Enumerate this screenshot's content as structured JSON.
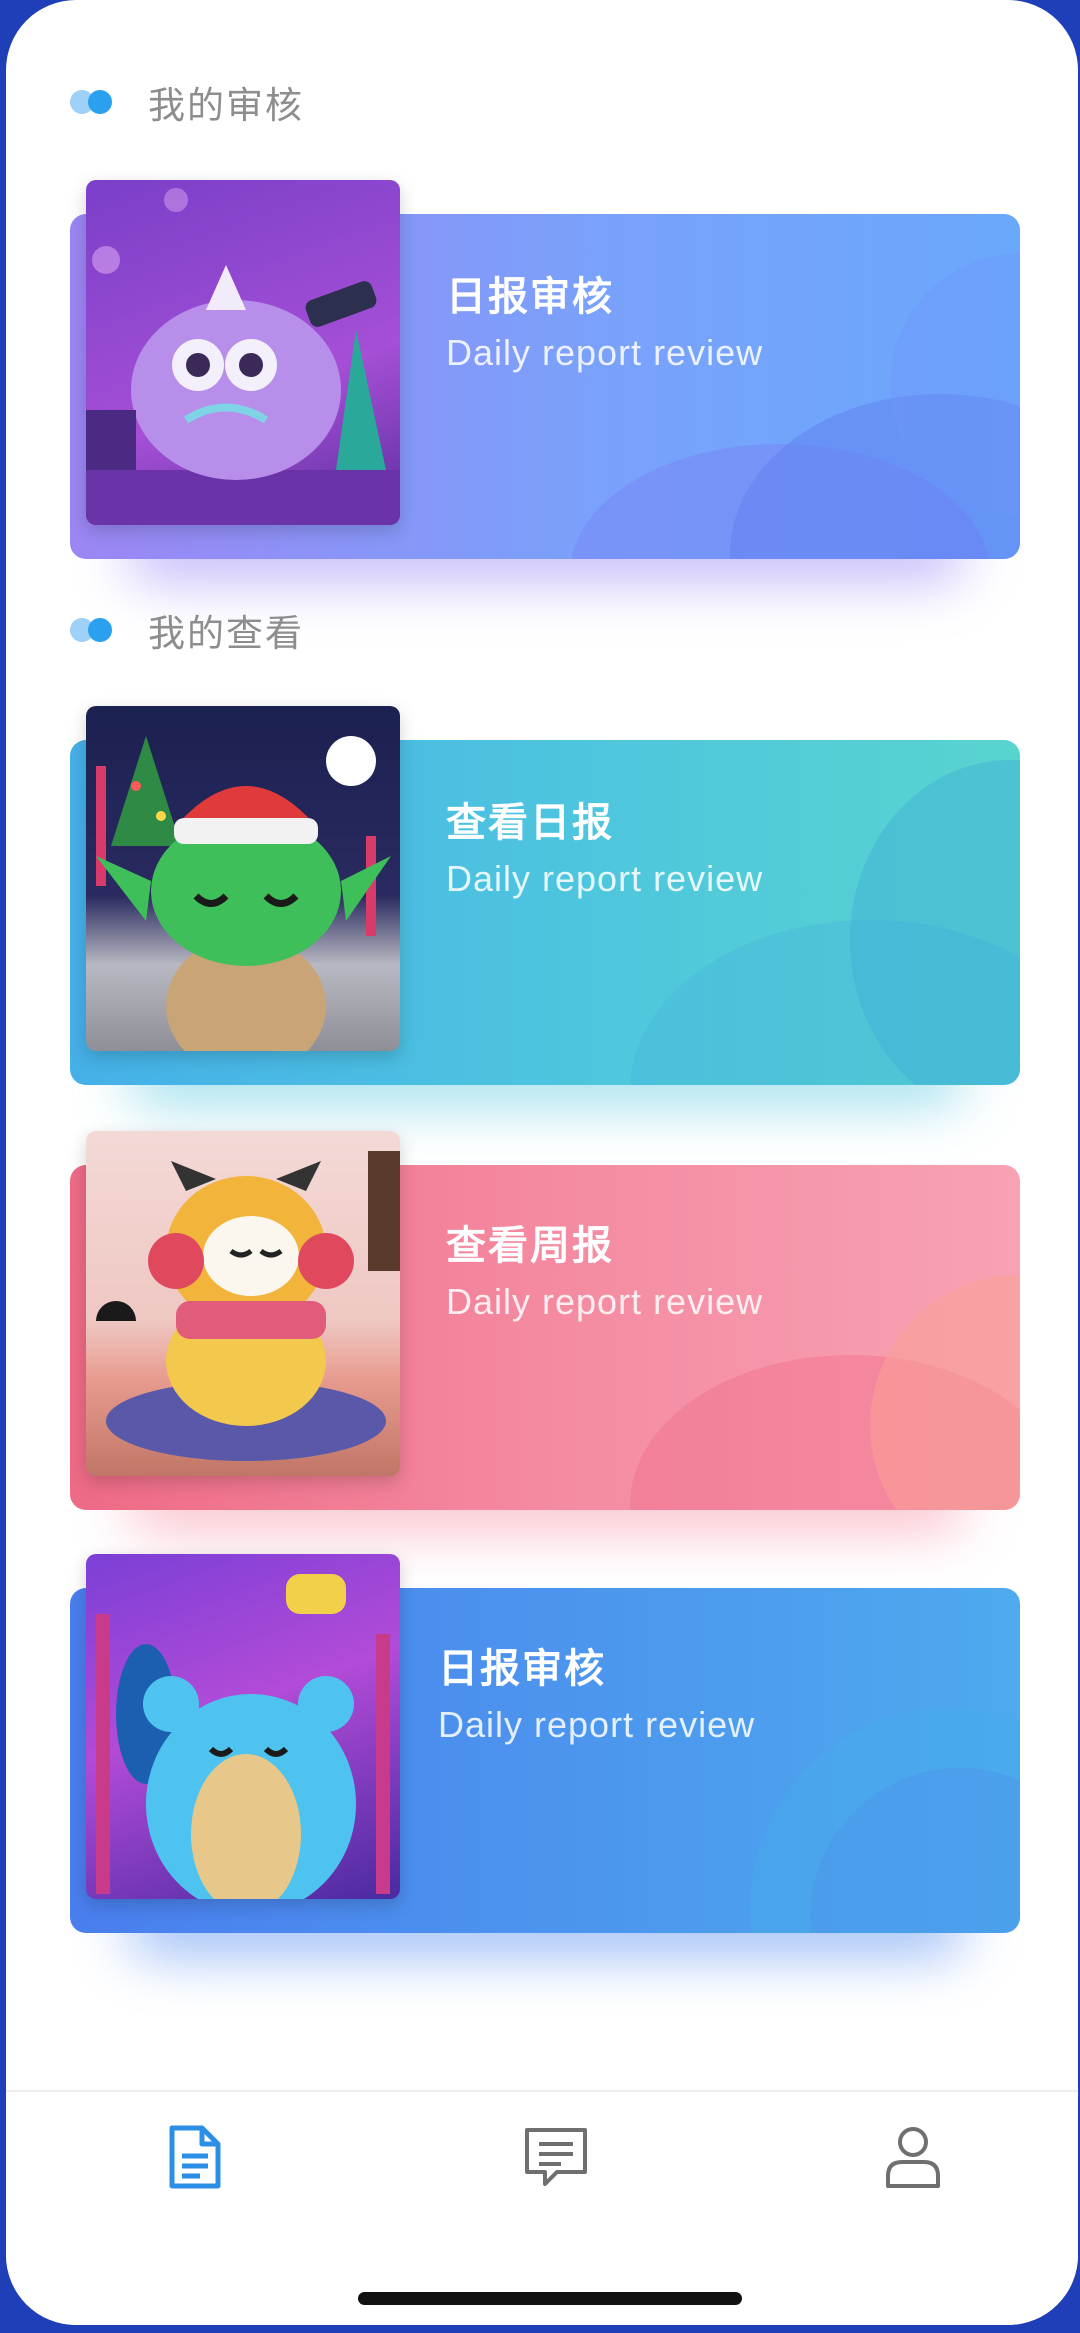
{
  "sections": {
    "review": {
      "title": "我的审核"
    },
    "view": {
      "title": "我的查看"
    }
  },
  "cards": [
    {
      "title": "日报审核",
      "subtitle": "Daily report review"
    },
    {
      "title": "查看日报",
      "subtitle": "Daily report review"
    },
    {
      "title": "查看周报",
      "subtitle": "Daily report review"
    },
    {
      "title": "日报审核",
      "subtitle": "Daily report review"
    }
  ],
  "tabbar": {
    "items": [
      {
        "icon": "document-icon",
        "active": true,
        "color": "#2b8fe6"
      },
      {
        "icon": "message-icon",
        "active": false,
        "color": "#6f6f6f"
      },
      {
        "icon": "user-icon",
        "active": false,
        "color": "#6f6f6f"
      }
    ]
  },
  "colors": {
    "accent": "#2aa0ef",
    "frame": "#1f3fb8",
    "card1": [
      "#9d85f3",
      "#6fa6fb"
    ],
    "card2": [
      "#3fb8e6",
      "#56d3d0"
    ],
    "card3": [
      "#f06d88",
      "#f9a7b7"
    ],
    "card4": [
      "#4a7fee",
      "#44aaee"
    ]
  }
}
